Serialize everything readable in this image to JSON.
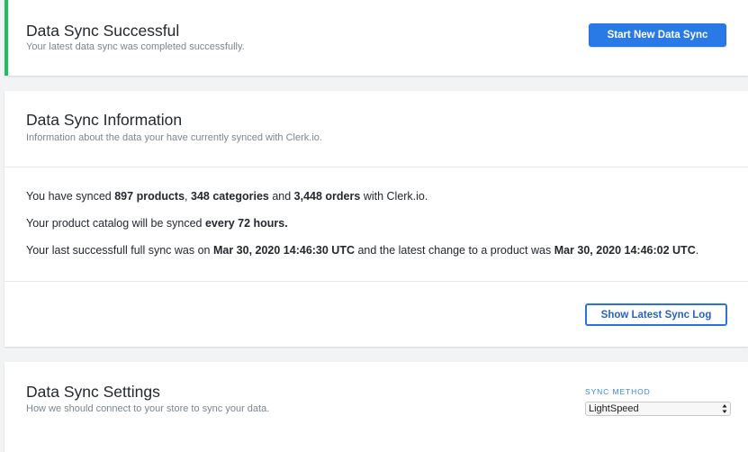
{
  "success_card": {
    "title": "Data Sync Successful",
    "subtitle": "Your latest data sync was completed successfully.",
    "button_label": "Start New Data Sync",
    "accent_color": "#1fbf5f"
  },
  "info_card": {
    "title": "Data Sync Information",
    "subtitle": "Information about the data your have currently synced with Clerk.io.",
    "line1": {
      "t1": "You have synced ",
      "products": "897 products",
      "t2": ", ",
      "categories": "348 categories",
      "t3": " and ",
      "orders": "3,448 orders",
      "t4": " with Clerk.io."
    },
    "line2": {
      "t1": "Your product catalog will be synced ",
      "interval": "every 72 hours."
    },
    "line3": {
      "t1": "Your last successfull full sync was on ",
      "full_sync": "Mar 30, 2020 14:46:30 UTC",
      "t2": " and the latest change to a product was ",
      "latest_change": "Mar 30, 2020 14:46:02 UTC",
      "t3": "."
    },
    "button_label": "Show Latest Sync Log"
  },
  "settings_card": {
    "title": "Data Sync Settings",
    "subtitle": "How we should connect to your store to sync your data.",
    "sync_method_label": "SYNC METHOD",
    "sync_method_value": "LightSpeed",
    "select_icon": "updown-arrows-icon"
  },
  "colors": {
    "primary": "#2979e6",
    "background": "#f2f3f5",
    "label_blue": "#3a86d8"
  }
}
